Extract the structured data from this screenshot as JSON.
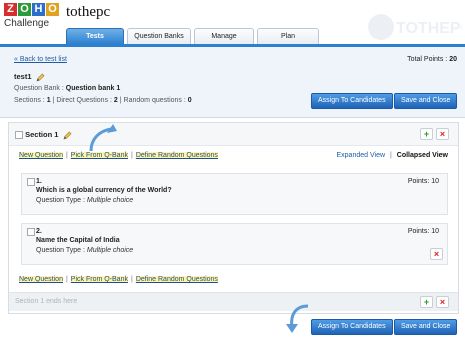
{
  "brand": {
    "letters": [
      "Z",
      "O",
      "H",
      "O"
    ],
    "letter_colors": [
      "#d62e2e",
      "#2c9a3a",
      "#2b6fcb",
      "#e0a21f"
    ],
    "subtitle": "Challenge"
  },
  "app_name": "tothepc",
  "background_logo": "TOTHEPC",
  "tabs": [
    {
      "label": "Tests",
      "active": true
    },
    {
      "label": "Question Banks",
      "active": false
    },
    {
      "label": "Manage",
      "active": false
    },
    {
      "label": "Plan",
      "active": false
    }
  ],
  "info": {
    "back_link": "« Back to test list",
    "total_points_label": "Total Points :",
    "total_points_value": "20",
    "test_name": "test1",
    "question_bank_label": "Question Bank :",
    "question_bank_value": "Question bank 1",
    "sections_label": "Sections :",
    "sections_value": "1",
    "direct_label": "| Direct Questions :",
    "direct_value": "2",
    "random_label": "| Random questions :",
    "random_value": "0"
  },
  "actions": {
    "assign": "Assign To Candidates",
    "save_close": "Save and Close"
  },
  "section": {
    "title": "Section 1",
    "links": [
      "New Question",
      "Pick From Q-Bank",
      "Define Random Questions"
    ],
    "separator": "|",
    "expanded_view": "Expanded View",
    "view_separator": "|",
    "collapsed_view": "Collapsed View",
    "questions": [
      {
        "number": "1.",
        "text": "Which is a global currency of the World?",
        "type_label": "Question Type :",
        "type_value": "Multiple choice",
        "points": "Points: 10"
      },
      {
        "number": "2.",
        "text": "Name the Capital of India",
        "type_label": "Question Type :",
        "type_value": "Multiple choice",
        "points": "Points: 10"
      }
    ],
    "end_text": "Section 1 ends here"
  },
  "icons": {
    "add": "plus-icon",
    "remove": "close-icon",
    "edit": "pencil-icon",
    "annotation": "curved-arrow-icon"
  },
  "colors": {
    "accent": "#2d7fd0",
    "link": "#1f5aa6",
    "highlight": "#fff4a8",
    "add": "#2e9b2e",
    "remove": "#dd2222"
  }
}
